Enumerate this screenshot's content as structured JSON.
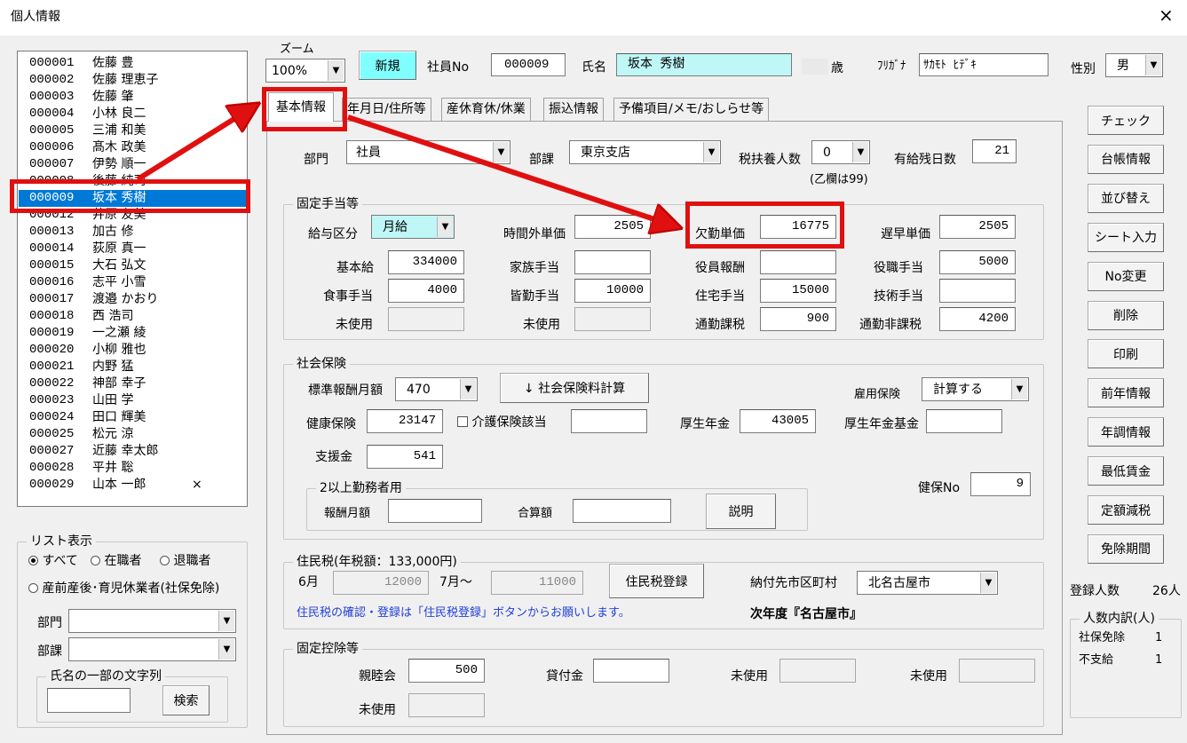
{
  "window": {
    "title": "個人情報",
    "close": "×"
  },
  "employee_list": [
    {
      "no": "000001",
      "name": "佐藤 豊",
      "mark": ""
    },
    {
      "no": "000002",
      "name": "佐藤 理恵子",
      "mark": ""
    },
    {
      "no": "000003",
      "name": "佐藤 肇",
      "mark": ""
    },
    {
      "no": "000004",
      "name": "小林 良二",
      "mark": ""
    },
    {
      "no": "000005",
      "name": "三浦 和美",
      "mark": ""
    },
    {
      "no": "000006",
      "name": "髙木 政美",
      "mark": ""
    },
    {
      "no": "000007",
      "name": "伊勢 順一",
      "mark": ""
    },
    {
      "no": "000008",
      "name": "後藤 純司",
      "mark": ""
    },
    {
      "no": "000009",
      "name": "坂本 秀樹",
      "mark": ""
    },
    {
      "no": "000012",
      "name": "井原 友美",
      "mark": ""
    },
    {
      "no": "000013",
      "name": "加古 修",
      "mark": ""
    },
    {
      "no": "000014",
      "name": "荻原 真一",
      "mark": ""
    },
    {
      "no": "000015",
      "name": "大石 弘文",
      "mark": ""
    },
    {
      "no": "000016",
      "name": "志平 小雪",
      "mark": ""
    },
    {
      "no": "000017",
      "name": "渡邉 かおり",
      "mark": ""
    },
    {
      "no": "000018",
      "name": "西 浩司",
      "mark": ""
    },
    {
      "no": "000019",
      "name": "一之瀬 綾",
      "mark": ""
    },
    {
      "no": "000020",
      "name": "小柳 雅也",
      "mark": ""
    },
    {
      "no": "000021",
      "name": "内野 猛",
      "mark": ""
    },
    {
      "no": "000022",
      "name": "神部 幸子",
      "mark": ""
    },
    {
      "no": "000023",
      "name": "山田 学",
      "mark": ""
    },
    {
      "no": "000024",
      "name": "田口 輝美",
      "mark": ""
    },
    {
      "no": "000025",
      "name": "松元 涼",
      "mark": ""
    },
    {
      "no": "000027",
      "name": "近藤 幸太郎",
      "mark": ""
    },
    {
      "no": "000028",
      "name": "平井 聡",
      "mark": ""
    },
    {
      "no": "000029",
      "name": "山本 一郎",
      "mark": "×"
    }
  ],
  "list_display": {
    "title": "リスト表示",
    "opt_all": "すべて",
    "opt_active": "在職者",
    "opt_retired": "退職者",
    "opt_leave": "産前産後･育児休業者(社保免除)",
    "dept_label": "部門",
    "section_label": "部課",
    "name_search_title": "氏名の一部の文字列",
    "search_button": "検索"
  },
  "header": {
    "zoom_label": "ズーム",
    "zoom_value": "100%",
    "new_button": "新規",
    "emp_no_label": "社員No",
    "emp_no": "000009",
    "name_label": "氏名",
    "name_value": "坂本 秀樹",
    "age_label": "歳",
    "kana_label": "ﾌﾘｶﾞﾅ",
    "kana_value": "ｻｶﾓﾄ ﾋﾃﾞｷ",
    "gender_label": "性別",
    "gender_value": "男"
  },
  "tabs": [
    "基本情報",
    "生年月日/住所等",
    "産休育休/休業",
    "振込情報",
    "予備項目/メモ/おしらせ等"
  ],
  "tabs_visible": [
    "基本情報",
    "年月日/住所等",
    "産休育休/休業",
    "振込情報",
    "予備項目/メモ/おしらせ等"
  ],
  "basic": {
    "dept_label": "部門",
    "dept_value": "社員",
    "section_label": "部課",
    "section_value": "東京支店",
    "dependents_label": "税扶養人数",
    "dependents_value": "0",
    "dependents_note": "(乙欄は99)",
    "paid_leave_label": "有給残日数",
    "paid_leave_value": "21"
  },
  "allowances": {
    "title": "固定手当等",
    "pay_type_label": "給与区分",
    "pay_type_value": "月給",
    "overtime_label": "時間外単価",
    "overtime_value": "2505",
    "absence_label": "欠勤単価",
    "absence_value": "16775",
    "late_label": "遅早単価",
    "late_value": "2505",
    "base_label": "基本給",
    "base_value": "334000",
    "family_label": "家族手当",
    "family_value": "",
    "officer_label": "役員報酬",
    "officer_value": "",
    "position_label": "役職手当",
    "position_value": "5000",
    "meal_label": "食事手当",
    "meal_value": "4000",
    "attendance_label": "皆勤手当",
    "attendance_value": "10000",
    "housing_label": "住宅手当",
    "housing_value": "15000",
    "skill_label": "技術手当",
    "skill_value": "",
    "unused1_label": "未使用",
    "unused2_label": "未使用",
    "commute_tax_label": "通勤課税",
    "commute_tax_value": "900",
    "commute_free_label": "通勤非課税",
    "commute_free_value": "4200"
  },
  "insurance": {
    "title": "社会保険",
    "std_monthly_label": "標準報酬月額",
    "std_monthly_value": "470",
    "calc_button": "↓ 社会保険料計算",
    "employment_label": "雇用保険",
    "employment_value": "計算する",
    "health_label": "健康保険",
    "health_value": "23147",
    "care_label": "介護保険該当",
    "care_value": "",
    "pension_label": "厚生年金",
    "pension_value": "43005",
    "pension_fund_label": "厚生年金基金",
    "pension_fund_value": "",
    "support_label": "支援金",
    "support_value": "541",
    "multi_title": "2以上勤務者用",
    "remuneration_label": "報酬月額",
    "remuneration_value": "",
    "total_label": "合算額",
    "total_value": "",
    "explain_button": "説明",
    "health_no_label": "健保No",
    "health_no_value": "9"
  },
  "resident_tax": {
    "title": "住民税(年税額：133,000円)",
    "june_label": "6月",
    "june_value": "12000",
    "july_label": "7月～",
    "july_value": "11000",
    "register_button": "住民税登録",
    "city_label": "納付先市区町村",
    "city_value": "北名古屋市",
    "note": "住民税の確認・登録は「住民税登録」ボタンからお願いします。",
    "next_year": "次年度『名古屋市』"
  },
  "deductions": {
    "title": "固定控除等",
    "social_label": "親睦会",
    "social_value": "500",
    "loan_label": "貸付金",
    "loan_value": "",
    "unused1_label": "未使用",
    "unused2_label": "未使用",
    "unused3_label": "未使用"
  },
  "side_buttons": [
    "チェック",
    "台帳情報",
    "並び替え",
    "シート入力",
    "No変更",
    "削除",
    "印刷",
    "前年情報",
    "年調情報",
    "最低賃金",
    "定額減税",
    "免除期間"
  ],
  "stats": {
    "registered_label": "登録人数",
    "registered_value": "26人",
    "breakdown_title": "人数内訳(人)",
    "exempt_label": "社保免除",
    "exempt_value": "1",
    "unpaid_label": "不支給",
    "unpaid_value": "1"
  },
  "colors": {
    "highlight": "#0078d7",
    "annotation": "#e01010",
    "name_bg": "#bff7f7",
    "new_btn": "#80ffff",
    "pay_type_bg": "#bff7f7"
  }
}
